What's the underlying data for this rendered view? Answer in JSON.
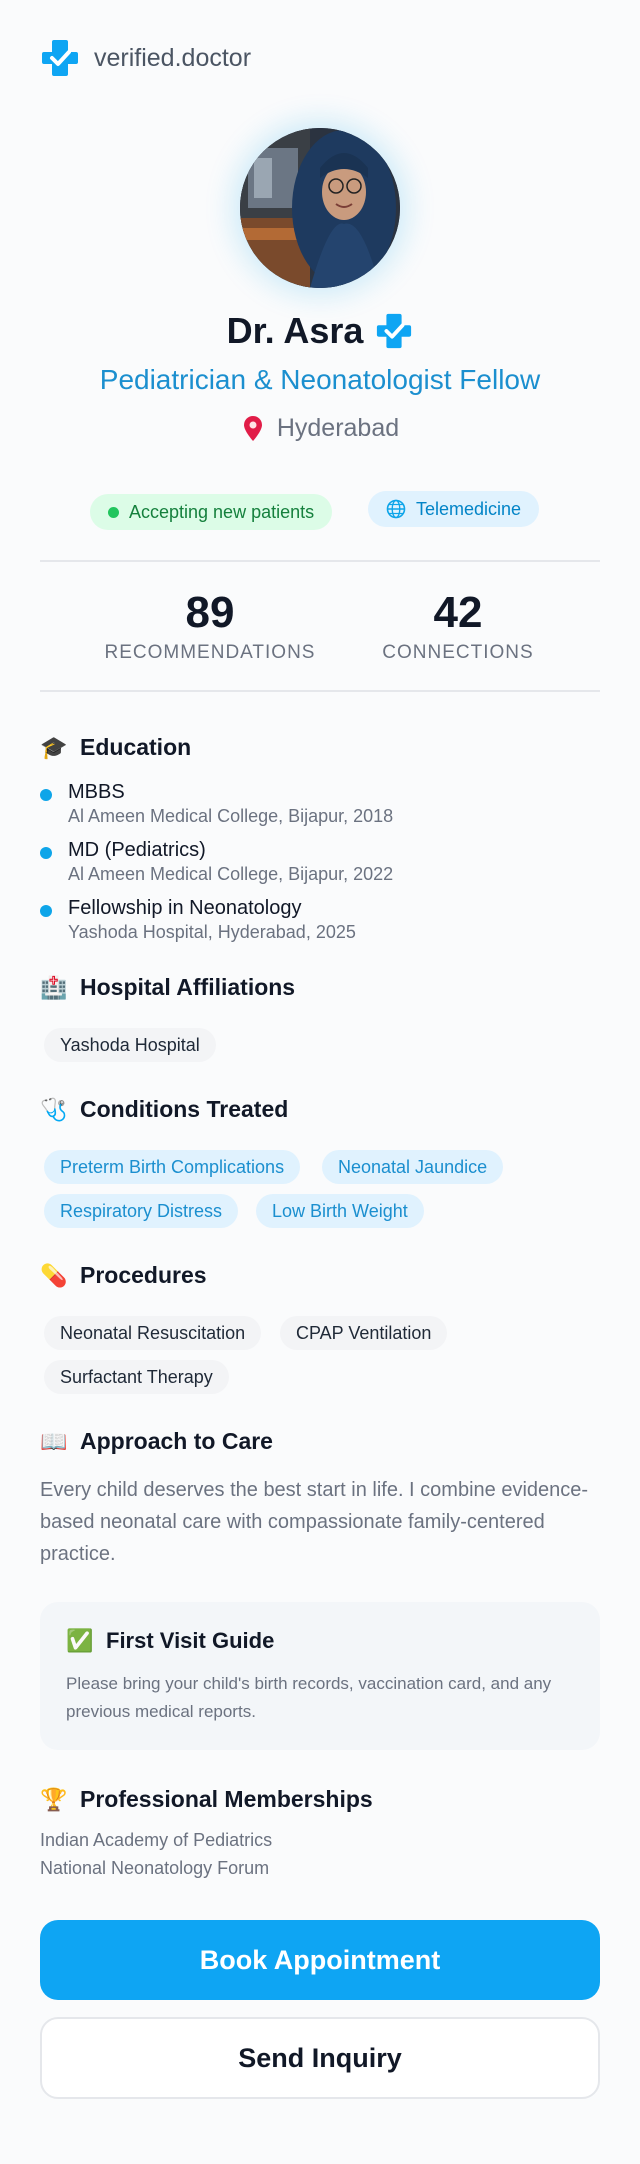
{
  "brand": {
    "name": "verified.doctor"
  },
  "profile": {
    "name": "Dr. Asra",
    "specialty": "Pediatrician & Neonatologist Fellow",
    "location": "Hyderabad"
  },
  "badges": {
    "accepting": "Accepting new patients",
    "telemedicine": "Telemedicine"
  },
  "stats": [
    {
      "value": "89",
      "label": "RECOMMENDATIONS"
    },
    {
      "value": "42",
      "label": "CONNECTIONS"
    }
  ],
  "education": {
    "title": "Education",
    "icon": "graduation-cap-icon",
    "items": [
      {
        "degree": "MBBS",
        "school": "Al Ameen Medical College, Bijapur, 2018"
      },
      {
        "degree": "MD (Pediatrics)",
        "school": "Al Ameen Medical College, Bijapur, 2022"
      },
      {
        "degree": "Fellowship in Neonatology",
        "school": "Yashoda Hospital, Hyderabad, 2025"
      }
    ]
  },
  "affiliations": {
    "title": "Hospital Affiliations",
    "icon": "hospital-icon",
    "items": [
      "Yashoda Hospital"
    ]
  },
  "conditions": {
    "title": "Conditions Treated",
    "icon": "stethoscope-icon",
    "items": [
      "Preterm Birth Complications",
      "Neonatal Jaundice",
      "Respiratory Distress",
      "Low Birth Weight"
    ]
  },
  "procedures": {
    "title": "Procedures",
    "icon": "pill-icon",
    "items": [
      "Neonatal Resuscitation",
      "CPAP Ventilation",
      "Surfactant Therapy"
    ]
  },
  "approach": {
    "title": "Approach to Care",
    "icon": "book-icon",
    "text": "Every child deserves the best start in life. I combine evidence-based neonatal care with compassionate family-centered practice."
  },
  "first_visit": {
    "title": "First Visit Guide",
    "icon": "check-box-icon",
    "text": "Please bring your child's birth records, vaccination card, and any previous medical reports."
  },
  "memberships": {
    "title": "Professional Memberships",
    "icon": "trophy-icon",
    "items": [
      "Indian Academy of Pediatrics",
      "National Neonatology Forum"
    ]
  },
  "actions": {
    "book": "Book Appointment",
    "inquiry": "Send Inquiry"
  },
  "colors": {
    "brand_blue": "#0ea5f3",
    "accent_text": "#1b8fcf",
    "success_green": "#15803d"
  }
}
